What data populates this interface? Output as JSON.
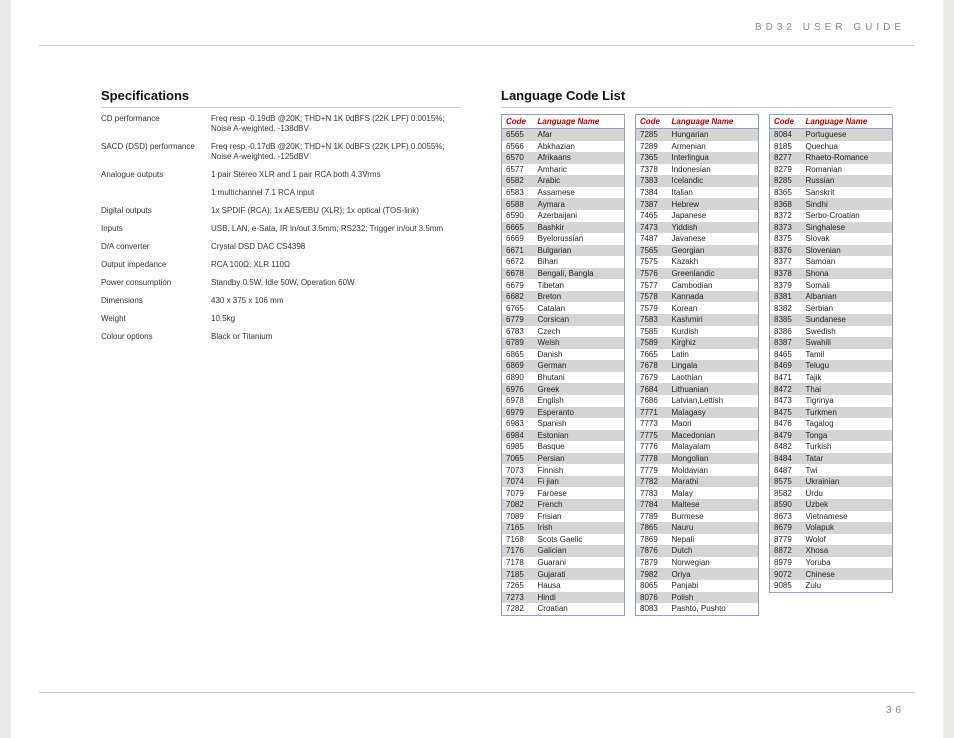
{
  "header": "BD32 USER GUIDE",
  "page_number": "36",
  "specs_heading": "Specifications",
  "specs": [
    {
      "label": "CD performance",
      "value": "Freq resp -0.19dB @20K; THD+N 1K 0dBFS (22K LPF) 0.0015%; Noise A-weighted. -138dBV"
    },
    {
      "label": "SACD (DSD) performance",
      "value": "Freq resp -0,17dB @20K; THD+N 1K 0dBFS (22K LPF) 0.0055%; Noise A-weighted. -125dBV"
    },
    {
      "label": "Analogue outputs",
      "value": "1 pair Stereo XLR and 1 pair RCA both 4.3Vrms"
    },
    {
      "label": "",
      "value": "1 multichannel 7.1 RCA input"
    },
    {
      "label": "Digital outputs",
      "value": "1x SPDIF (RCA); 1x AES/EBU (XLR); 1x optical (TOS-link)"
    },
    {
      "label": "Inputs",
      "value": "USB, LAN, e-Sata, IR in/out 3.5mm; RS232; Trigger in/out 3.5mm"
    },
    {
      "label": "D/A converter",
      "value": "Crystal DSD DAC CS4398"
    },
    {
      "label": "Output impedance",
      "value": "RCA 100Ω; XLR 110Ω"
    },
    {
      "label": "Power consumption",
      "value": "Standby 0.5W, Idle 50W, Operation 60W"
    },
    {
      "label": "Dimensions",
      "value": "430 x 375 x 106 mm"
    },
    {
      "label": "Weight",
      "value": "10.5kg"
    },
    {
      "label": "Colour options",
      "value": "Black or Titanium"
    }
  ],
  "lang_heading": "Language Code List",
  "lang_header_code": "Code",
  "lang_header_name": "Language Name",
  "lang_cols": [
    [
      [
        "6565",
        "Afar"
      ],
      [
        "6566",
        "Abkhazian"
      ],
      [
        "6570",
        "Afrikaans"
      ],
      [
        "6577",
        "Amharic"
      ],
      [
        "6582",
        "Arabic"
      ],
      [
        "6583",
        "Assamese"
      ],
      [
        "6588",
        "Aymara"
      ],
      [
        "6590",
        "Azerbaijani"
      ],
      [
        "6665",
        "Bashkir"
      ],
      [
        "6669",
        "Byelorussian"
      ],
      [
        "6671",
        "Bulgarian"
      ],
      [
        "6672",
        "Bihari"
      ],
      [
        "6678",
        "Bengali, Bangla"
      ],
      [
        "6679",
        "Tibetan"
      ],
      [
        "6682",
        "Breton"
      ],
      [
        "6765",
        "Catalan"
      ],
      [
        "6779",
        "Corsican"
      ],
      [
        "6783",
        "Czech"
      ],
      [
        "6789",
        "Welsh"
      ],
      [
        "6865",
        "Danish"
      ],
      [
        "6869",
        "German"
      ],
      [
        "6890",
        "Bhutani"
      ],
      [
        "6976",
        "Greek"
      ],
      [
        "6978",
        "English"
      ],
      [
        "6979",
        "Esperanto"
      ],
      [
        "6983",
        "Spanish"
      ],
      [
        "6984",
        "Estonian"
      ],
      [
        "6985",
        "Basque"
      ],
      [
        "7065",
        "Persian"
      ],
      [
        "7073",
        "Finnish"
      ],
      [
        "7074",
        "Fi jian"
      ],
      [
        "7079",
        "Faroese"
      ],
      [
        "7082",
        "French"
      ],
      [
        "7089",
        "Frisian"
      ],
      [
        "7165",
        "Irish"
      ],
      [
        "7168",
        "Scots Gaelic"
      ],
      [
        "7176",
        "Galician"
      ],
      [
        "7178",
        "Guarani"
      ],
      [
        "7185",
        "Gujarati"
      ],
      [
        "7265",
        "Hausa"
      ],
      [
        "7273",
        "Hindi"
      ],
      [
        "7282",
        "Croatian"
      ]
    ],
    [
      [
        "7285",
        "Hungarian"
      ],
      [
        "7289",
        "Armenian"
      ],
      [
        "7365",
        "Interlingua"
      ],
      [
        "7378",
        "Indonesian"
      ],
      [
        "7383",
        "Icelandic"
      ],
      [
        "7384",
        "Italian"
      ],
      [
        "7387",
        "Hebrew"
      ],
      [
        "7465",
        "Japanese"
      ],
      [
        "7473",
        "Yiddish"
      ],
      [
        "7487",
        "Javanese"
      ],
      [
        "7565",
        "Georgian"
      ],
      [
        "7575",
        "Kazakh"
      ],
      [
        "7576",
        "Greenlandic"
      ],
      [
        "7577",
        "Cambodian"
      ],
      [
        "7578",
        "Kannada"
      ],
      [
        "7579",
        "Korean"
      ],
      [
        "7583",
        "Kashmiri"
      ],
      [
        "7585",
        "Kurdish"
      ],
      [
        "7589",
        "Kirghiz"
      ],
      [
        "7665",
        "Latin"
      ],
      [
        "7678",
        "Lingala"
      ],
      [
        "7679",
        "Laothian"
      ],
      [
        "7684",
        "Lithuanian"
      ],
      [
        "7686",
        "Latvian,Lettish"
      ],
      [
        "7771",
        "Malagasy"
      ],
      [
        "7773",
        "Maori"
      ],
      [
        "7775",
        "Macedonian"
      ],
      [
        "7776",
        "Malayalam"
      ],
      [
        "7778",
        "Mongolian"
      ],
      [
        "7779",
        "Moldavian"
      ],
      [
        "7782",
        "Marathi"
      ],
      [
        "7783",
        "Malay"
      ],
      [
        "7784",
        "Maltese"
      ],
      [
        "7789",
        "Burmese"
      ],
      [
        "7865",
        "Nauru"
      ],
      [
        "7869",
        "Nepali"
      ],
      [
        "7876",
        "Dutch"
      ],
      [
        "7879",
        "Norwegian"
      ],
      [
        "7982",
        "Oriya"
      ],
      [
        "8065",
        "Panjabi"
      ],
      [
        "8076",
        "Polish"
      ],
      [
        "8083",
        "Pashto, Pushto"
      ]
    ],
    [
      [
        "8084",
        "Portuguese"
      ],
      [
        "8185",
        "Quechua"
      ],
      [
        "8277",
        "Rhaeto-Romance"
      ],
      [
        "8279",
        "Romanian"
      ],
      [
        "8285",
        "Russian"
      ],
      [
        "8365",
        "Sanskrit"
      ],
      [
        "8368",
        "Sindhi"
      ],
      [
        "8372",
        "Serbo-Croatian"
      ],
      [
        "8373",
        "Singhalese"
      ],
      [
        "8375",
        "Slovak"
      ],
      [
        "8376",
        "Slovenian"
      ],
      [
        "8377",
        "Samoan"
      ],
      [
        "8378",
        "Shona"
      ],
      [
        "8379",
        "Somali"
      ],
      [
        "8381",
        "Albanian"
      ],
      [
        "8382",
        "Serbian"
      ],
      [
        "8385",
        "Sundanese"
      ],
      [
        "8386",
        "Swedish"
      ],
      [
        "8387",
        "Swahili"
      ],
      [
        "8465",
        "Tamil"
      ],
      [
        "8469",
        "Telugu"
      ],
      [
        "8471",
        "Tajik"
      ],
      [
        "8472",
        "Thai"
      ],
      [
        "8473",
        "Tigrinya"
      ],
      [
        "8475",
        "Turkmen"
      ],
      [
        "8476",
        "Tagalog"
      ],
      [
        "8479",
        "Tonga"
      ],
      [
        "8482",
        "Turkish"
      ],
      [
        "8484",
        "Tatar"
      ],
      [
        "8487",
        "Twi"
      ],
      [
        "8575",
        "Ukrainian"
      ],
      [
        "8582",
        "Urdu"
      ],
      [
        "8590",
        "Uzbek"
      ],
      [
        "8673",
        "Vietnamese"
      ],
      [
        "8679",
        "Volapuk"
      ],
      [
        "8779",
        "Wolof"
      ],
      [
        "8872",
        "Xhosa"
      ],
      [
        "8979",
        "Yoruba"
      ],
      [
        "9072",
        "Chinese"
      ],
      [
        "9085",
        "Zulu"
      ]
    ]
  ]
}
